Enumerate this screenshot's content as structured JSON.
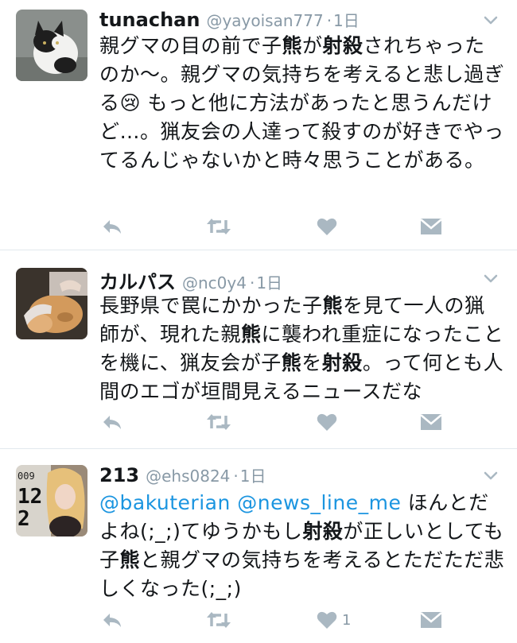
{
  "tweets": [
    {
      "name": "tunachan",
      "handle": "@yayoisan777",
      "sep": "·",
      "time": "1日",
      "t1": "親グマの目の前で子",
      "t2": "熊",
      "t3": "が",
      "t4": "射殺",
      "t5": "されちゃったのか〜。親グマの気持ちを考えると悲し過ぎる",
      "emoji": "😢",
      "t6": " もっと他に方法があったと思うんだけど…。猟友会の人達って殺すのが好きでやってるんじゃないかと時々思うことがある。",
      "like_count": ""
    },
    {
      "name": "カルパス",
      "handle": "@nc0y4",
      "sep": "·",
      "time": "1日",
      "t1": "長野県で罠にかかった子",
      "t2": "熊",
      "t3": "を見て一人の猟師が、現れた親",
      "t4": "熊",
      "t5": "に襲われ重症になったことを機に、猟友会が子",
      "t6": "熊",
      "t7": "を",
      "t8": "射殺",
      "t9": "。って何とも人間のエゴが垣間見えるニュースだな",
      "like_count": ""
    },
    {
      "name": "213",
      "handle": "@ehs0824",
      "sep": "·",
      "time": "1日",
      "m1": "@bakuterian",
      "m2": "@news_line_me",
      "t1": " ほんとだよね(;_;)てゆうかもし",
      "t2": "射殺",
      "t3": "が正しいとしても子",
      "t4": "熊",
      "t5": "と親グマの気持ちを考えるとただただ悲しくなった(;_;)",
      "like_count": "1"
    }
  ],
  "icons": [
    "reply-icon",
    "retweet-icon",
    "like-icon",
    "direct-message-icon",
    "chevron-down-icon"
  ],
  "colors": {
    "icon": "#aab8c2",
    "mention": "#1b95e0",
    "handle": "#8899a6"
  }
}
